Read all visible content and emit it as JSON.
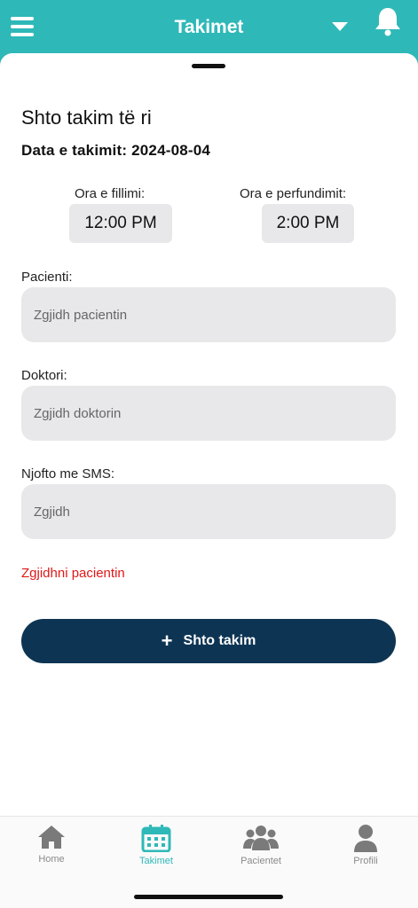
{
  "header": {
    "title": "Takimet"
  },
  "form": {
    "title": "Shto takim të ri",
    "date_line": "Data e takimit: 2024-08-04",
    "start_time": {
      "label": "Ora e fillimi:",
      "value": "12:00 PM"
    },
    "end_time": {
      "label": "Ora e perfundimit:",
      "value": "2:00 PM"
    },
    "patient": {
      "label": "Pacienti:",
      "placeholder": "Zgjidh pacientin"
    },
    "doctor": {
      "label": "Doktori:",
      "placeholder": "Zgjidh doktorin"
    },
    "sms": {
      "label": "Njofto me SMS:",
      "placeholder": "Zgjidh"
    },
    "error": "Zgjidhni pacientin",
    "submit_label": "Shto takim"
  },
  "tabs": [
    {
      "label": "Home",
      "icon": "home-icon",
      "active": false
    },
    {
      "label": "Takimet",
      "icon": "calendar-icon",
      "active": true
    },
    {
      "label": "Pacientet",
      "icon": "people-icon",
      "active": false
    },
    {
      "label": "Profili",
      "icon": "user-icon",
      "active": false
    }
  ],
  "colors": {
    "accent": "#2fb8b8",
    "button": "#0d3553",
    "error": "#e01818",
    "field_bg": "#e8e8ea"
  }
}
